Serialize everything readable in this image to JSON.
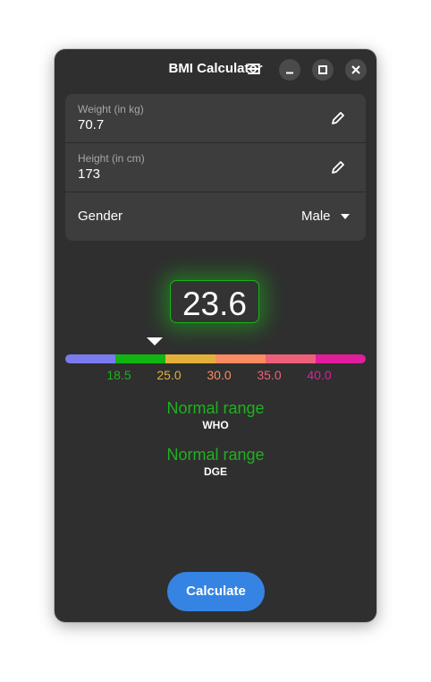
{
  "window": {
    "title": "BMI Calculator"
  },
  "titlebar": {
    "menu_icon": "hamburger-menu-icon",
    "minimize_icon": "minimize-icon",
    "maximize_icon": "maximize-icon",
    "close_icon": "close-icon"
  },
  "form": {
    "weight": {
      "label": "Weight (in kg)",
      "value": "70.7",
      "icon": "pencil-icon"
    },
    "height": {
      "label": "Height (in cm)",
      "value": "173",
      "icon": "pencil-icon"
    },
    "gender": {
      "label": "Gender",
      "value": "Male",
      "icon": "chevron-down-icon"
    }
  },
  "result": {
    "bmi": "23.6",
    "bmi_value": 23.6,
    "accent_color": "#1db21d"
  },
  "scale": {
    "segments": [
      {
        "color": "#7b7bf0"
      },
      {
        "color": "#11b511"
      },
      {
        "color": "#e3b13a"
      },
      {
        "color": "#fb8b62"
      },
      {
        "color": "#ee607a"
      },
      {
        "color": "#e01e9c"
      }
    ],
    "ticks": [
      {
        "label": "18.5",
        "color": "#1db21d"
      },
      {
        "label": "25.0",
        "color": "#e3b13a"
      },
      {
        "label": "30.0",
        "color": "#fb8b62"
      },
      {
        "label": "35.0",
        "color": "#ee607a"
      },
      {
        "label": "40.0",
        "color": "#e01e9c"
      }
    ]
  },
  "classifications": [
    {
      "label": "Normal range",
      "source": "WHO"
    },
    {
      "label": "Normal range",
      "source": "DGE"
    }
  ],
  "actions": {
    "calculate_label": "Calculate",
    "calculate_color": "#3584e4"
  }
}
